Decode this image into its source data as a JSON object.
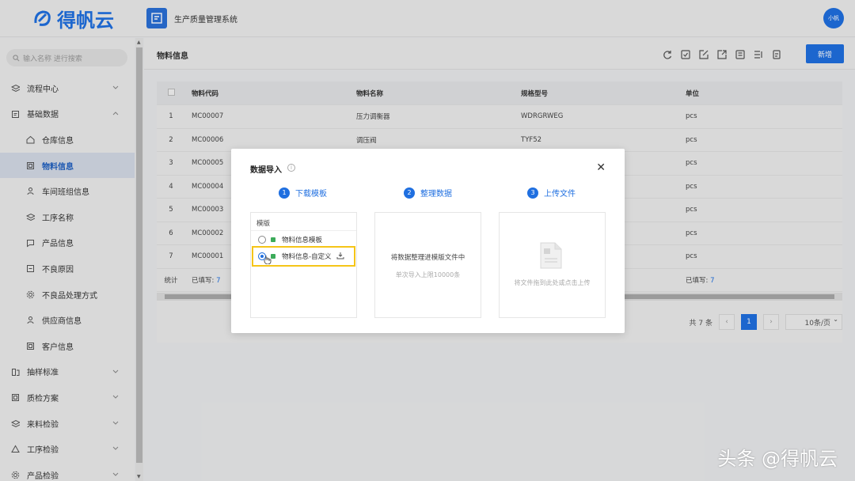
{
  "header": {
    "brand": "得帆云",
    "app_title": "生产质量管理系统",
    "user": "小帆"
  },
  "sidebar": {
    "search_placeholder": "输入名称 进行搜索",
    "items": [
      {
        "label": "流程中心",
        "sub": false,
        "chev": "down",
        "icon": "layers-icon"
      },
      {
        "label": "基础数据",
        "sub": false,
        "chev": "up",
        "icon": "database-icon"
      },
      {
        "label": "仓库信息",
        "sub": true,
        "icon": "home-icon"
      },
      {
        "label": "物料信息",
        "sub": true,
        "active": true,
        "icon": "box-icon"
      },
      {
        "label": "车间班组信息",
        "sub": true,
        "icon": "user-icon"
      },
      {
        "label": "工序名称",
        "sub": true,
        "icon": "layers-icon"
      },
      {
        "label": "产品信息",
        "sub": true,
        "icon": "message-icon"
      },
      {
        "label": "不良原因",
        "sub": true,
        "icon": "minus-square-icon"
      },
      {
        "label": "不良品处理方式",
        "sub": true,
        "icon": "gear-icon"
      },
      {
        "label": "供应商信息",
        "sub": true,
        "icon": "user-icon"
      },
      {
        "label": "客户信息",
        "sub": true,
        "icon": "box-icon"
      },
      {
        "label": "抽样标准",
        "sub": false,
        "chev": "down",
        "icon": "sample-icon"
      },
      {
        "label": "质检方案",
        "sub": false,
        "chev": "down",
        "icon": "box-icon"
      },
      {
        "label": "来料检验",
        "sub": false,
        "chev": "down",
        "icon": "layers-icon"
      },
      {
        "label": "工序检验",
        "sub": false,
        "chev": "down",
        "icon": "triangle-icon"
      },
      {
        "label": "产品检验",
        "sub": false,
        "chev": "down",
        "icon": "gear-icon"
      }
    ]
  },
  "page": {
    "title": "物料信息",
    "add_label": "新增"
  },
  "table": {
    "headers": [
      "物料代码",
      "物料名称",
      "规格型号",
      "单位"
    ],
    "rows": [
      {
        "n": "1",
        "code": "MC00007",
        "name": "压力调衡器",
        "spec": "WDRGRWEG",
        "unit": "pcs"
      },
      {
        "n": "2",
        "code": "MC00006",
        "name": "调压阀",
        "spec": "TYF52",
        "unit": "pcs"
      },
      {
        "n": "3",
        "code": "MC00005",
        "name": "",
        "spec": "",
        "unit": "pcs"
      },
      {
        "n": "4",
        "code": "MC00004",
        "name": "",
        "spec": "",
        "unit": "pcs"
      },
      {
        "n": "5",
        "code": "MC00003",
        "name": "",
        "spec": "",
        "unit": "pcs"
      },
      {
        "n": "6",
        "code": "MC00002",
        "name": "",
        "spec": "",
        "unit": "pcs"
      },
      {
        "n": "7",
        "code": "MC00001",
        "name": "",
        "spec": "",
        "unit": "pcs"
      }
    ],
    "stat_label": "统计",
    "filled_prefix": "已填写:",
    "filled_count": "7"
  },
  "pager": {
    "total": "共 7 条",
    "current": "1",
    "size": "10条/页"
  },
  "modal": {
    "title": "数据导入",
    "steps": [
      {
        "num": "1",
        "label": "下载模板"
      },
      {
        "num": "2",
        "label": "整理数据"
      },
      {
        "num": "3",
        "label": "上传文件"
      }
    ],
    "template_header": "模版",
    "options": [
      {
        "label": "物料信息模板",
        "selected": false
      },
      {
        "label": "物料信息-自定义",
        "selected": true
      }
    ],
    "organize_text": "将数据整理进模版文件中",
    "limit_text": "单次导入上限10000条",
    "upload_text": "将文件拖到此处或点击上传"
  },
  "watermark": "头条 @得帆云"
}
